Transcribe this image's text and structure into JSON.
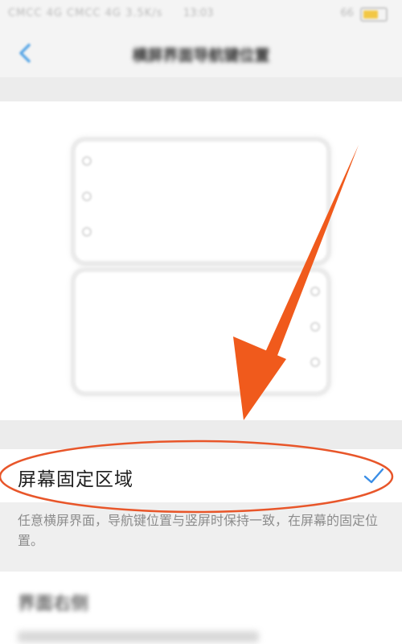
{
  "status_bar": {
    "carrier": "CMCC 4G  CMCC 4G  3.5K/s",
    "time": "13:03",
    "battery": "66"
  },
  "header": {
    "title": "横屏界面导航键位置"
  },
  "option": {
    "label": "屏幕固定区域",
    "selected": true,
    "description": "任意横屏界面，导航键位置与竖屏时保持一致，在屏幕的固定位置。"
  },
  "second_option": {
    "label": "界面右侧"
  },
  "annotation": {
    "arrow_color": "#f05a1c",
    "circle_color": "#e8562a"
  },
  "colors": {
    "check": "#3a8ee6",
    "back": "#5aa7e6"
  }
}
